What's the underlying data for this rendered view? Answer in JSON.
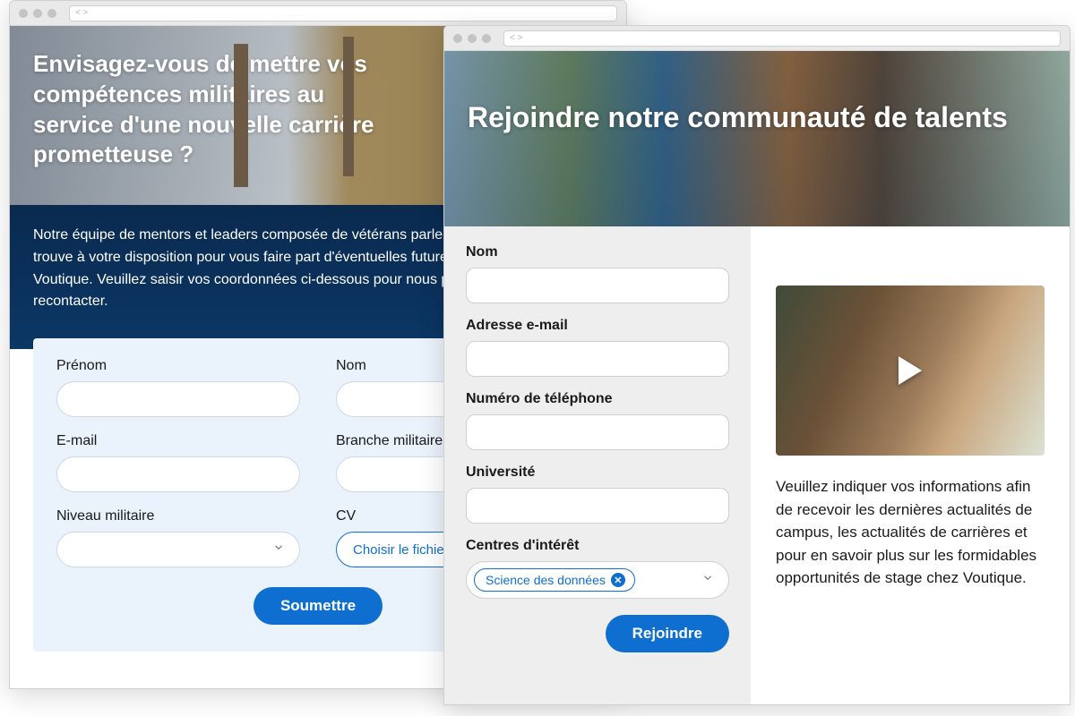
{
  "windowA": {
    "hero_title": "Envisagez-vous de mettre vos compétences militaires au service d'une nouvelle carrière prometteuse ?",
    "description": "Notre équipe de mentors et leaders composée de vétérans parle le même langage et se trouve à votre disposition pour vous faire part d'éventuelles futures opportunités chez Voutique. Veuillez saisir vos coordonnées ci-dessous pour nous permettre de vous recontacter.",
    "fields": {
      "first_name": "Prénom",
      "last_name": "Nom",
      "email": "E-mail",
      "military_branch": "Branche militaire",
      "military_level": "Niveau militaire",
      "cv": "CV",
      "file_button": "Choisir le fichier"
    },
    "submit": "Soumettre"
  },
  "windowB": {
    "hero_title": "Rejoindre notre communauté de talents",
    "fields": {
      "name": "Nom",
      "email": "Adresse e-mail",
      "phone": "Numéro de téléphone",
      "university": "Université",
      "interests": "Centres d'intérêt"
    },
    "chip": "Science des données",
    "submit": "Rejoindre",
    "right_text": "Veuillez indiquer vos informations afin de recevoir les dernières actualités de campus, les actualités de carrières et pour en savoir plus sur les formidables opportunités de stage chez Voutique."
  }
}
